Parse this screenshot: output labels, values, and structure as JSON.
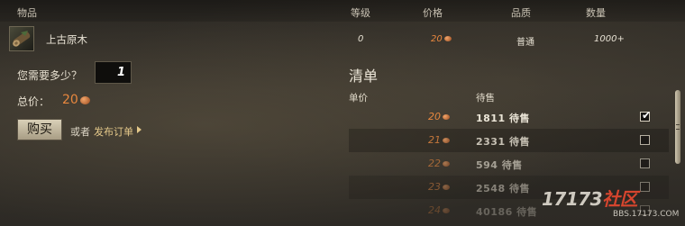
{
  "header": {
    "col_item": "物品",
    "col_level": "等级",
    "col_price": "价格",
    "col_quality": "品质",
    "col_quantity": "数量"
  },
  "item": {
    "icon": "ancient-wood-log-icon",
    "name": "上古原木",
    "level": "0",
    "price": "20",
    "quality": "普通",
    "quantity": "1000+"
  },
  "buy_panel": {
    "qty_label": "您需要多少？",
    "qty_value": "1",
    "total_label": "总价：",
    "total_value": "20",
    "buy_button": "购买",
    "or_text": "或者",
    "post_order_link": "发布订单"
  },
  "listing": {
    "title": "清单",
    "col_unit_price": "单价",
    "col_for_sale": "待售",
    "rows": [
      {
        "price": "20",
        "count": "1811 待售",
        "checked": true,
        "opacity": 1.0
      },
      {
        "price": "21",
        "count": "2331 待售",
        "checked": false,
        "opacity": 0.78
      },
      {
        "price": "22",
        "count": "594 待售",
        "checked": false,
        "opacity": 0.6
      },
      {
        "price": "23",
        "count": "2548 待售",
        "checked": false,
        "opacity": 0.45
      },
      {
        "price": "24",
        "count": "40186 待售",
        "checked": false,
        "opacity": 0.3
      }
    ]
  },
  "watermark": {
    "logo_a": "17173",
    "logo_b": "社区",
    "url": "BBS.17173.COM"
  },
  "colors": {
    "currency": "#e8873e",
    "text": "#d6d0c2",
    "link": "#e4c88a"
  }
}
